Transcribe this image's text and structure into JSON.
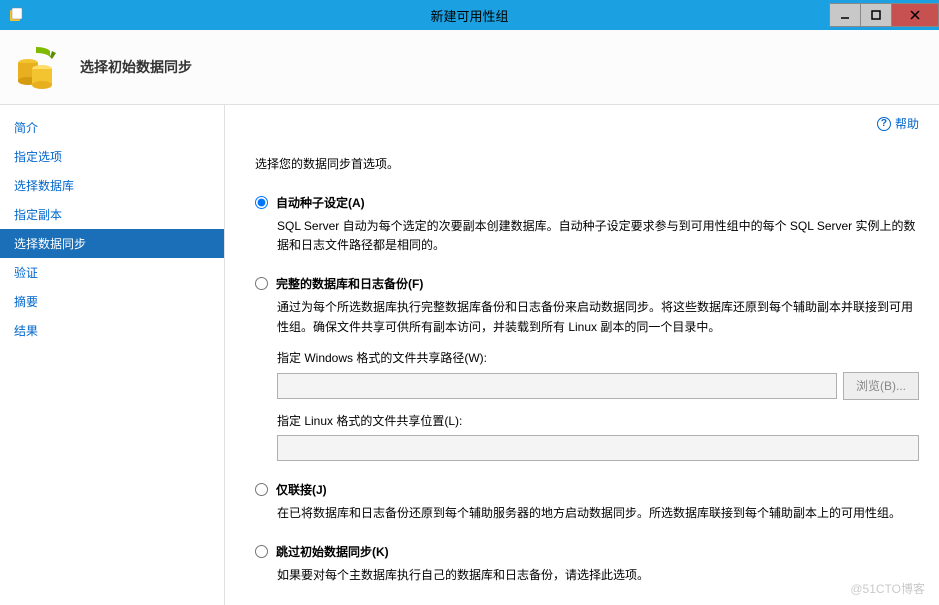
{
  "window": {
    "title": "新建可用性组"
  },
  "header": {
    "title": "选择初始数据同步"
  },
  "sidebar": {
    "items": [
      {
        "label": "简介"
      },
      {
        "label": "指定选项"
      },
      {
        "label": "选择数据库"
      },
      {
        "label": "指定副本"
      },
      {
        "label": "选择数据同步"
      },
      {
        "label": "验证"
      },
      {
        "label": "摘要"
      },
      {
        "label": "结果"
      }
    ]
  },
  "help": {
    "label": "帮助"
  },
  "content": {
    "prompt": "选择您的数据同步首选项。",
    "options": [
      {
        "key": "auto-seed",
        "title": "自动种子设定(A)",
        "desc": "SQL Server 自动为每个选定的次要副本创建数据库。自动种子设定要求参与到可用性组中的每个 SQL Server 实例上的数据和日志文件路径都是相同的。"
      },
      {
        "key": "full-backup",
        "title": "完整的数据库和日志备份(F)",
        "desc": "通过为每个所选数据库执行完整数据库备份和日志备份来启动数据同步。将这些数据库还原到每个辅助副本并联接到可用性组。确保文件共享可供所有副本访问，并装载到所有 Linux 副本的同一个目录中。",
        "paths": {
          "win_label": "指定 Windows 格式的文件共享路径(W):",
          "win_value": "",
          "browse_label": "浏览(B)...",
          "linux_label": "指定 Linux 格式的文件共享位置(L):",
          "linux_value": ""
        }
      },
      {
        "key": "join-only",
        "title": "仅联接(J)",
        "desc": "在已将数据库和日志备份还原到每个辅助服务器的地方启动数据同步。所选数据库联接到每个辅助副本上的可用性组。"
      },
      {
        "key": "skip",
        "title": "跳过初始数据同步(K)",
        "desc": "如果要对每个主数据库执行自己的数据库和日志备份，请选择此选项。"
      }
    ],
    "watermark": "@51CTO博客"
  }
}
